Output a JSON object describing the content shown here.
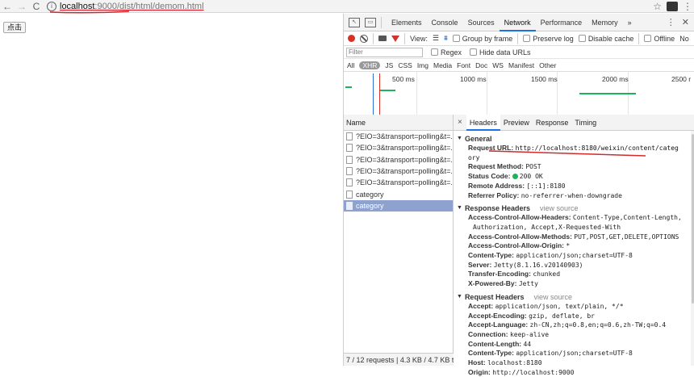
{
  "browser": {
    "url_host": "localhost",
    "url_rest": ":9000/dist/html/demom.html"
  },
  "page": {
    "button_label": "点击"
  },
  "devtools": {
    "tabs": [
      "Elements",
      "Console",
      "Sources",
      "Network",
      "Performance",
      "Memory"
    ],
    "more_tabs": "»",
    "toolbar": {
      "view_label": "View:",
      "group_by_frame": "Group by frame",
      "preserve_log": "Preserve log",
      "disable_cache": "Disable cache",
      "offline": "Offline",
      "no_throttling": "No"
    },
    "filter": {
      "placeholder": "Filter",
      "regex": "Regex",
      "hide_data_urls": "Hide data URLs"
    },
    "types": [
      "All",
      "XHR",
      "JS",
      "CSS",
      "Img",
      "Media",
      "Font",
      "Doc",
      "WS",
      "Manifest",
      "Other"
    ],
    "active_type": "XHR",
    "overview_ticks": [
      "500 ms",
      "1000 ms",
      "1500 ms",
      "2000 ms",
      "2500 r"
    ],
    "name_header": "Name",
    "requests": [
      "?EIO=3&transport=polling&t=...",
      "?EIO=3&transport=polling&t=...",
      "?EIO=3&transport=polling&t=...",
      "?EIO=3&transport=polling&t=...",
      "?EIO=3&transport=polling&t=...",
      "category",
      "category"
    ],
    "selected_request_index": 6,
    "status_bar": "7 / 12 requests | 4.3 KB / 4.7 KB t...",
    "detail_tabs": [
      "Headers",
      "Preview",
      "Response",
      "Timing"
    ],
    "active_detail_tab": "Headers",
    "general": {
      "title": "General",
      "request_url_label": "Request URL:",
      "request_url_line1": "http://localhost:8180/weixin/content/categ",
      "request_url_line2": "ory",
      "request_method_label": "Request Method:",
      "request_method": "POST",
      "status_code_label": "Status Code:",
      "status_code": "200 OK",
      "status_color": "#1db35c",
      "remote_address_label": "Remote Address:",
      "remote_address": "[::1]:8180",
      "referrer_policy_label": "Referrer Policy:",
      "referrer_policy": "no-referrer-when-downgrade"
    },
    "response_headers": {
      "title": "Response Headers",
      "view_source": "view source",
      "acah_label": "Access-Control-Allow-Headers:",
      "acah_line1": "Content-Type,Content-Length,",
      "acah_line2": "Authorization, Accept,X-Requested-With",
      "acam_label": "Access-Control-Allow-Methods:",
      "acam": "PUT,POST,GET,DELETE,OPTIONS",
      "acao_label": "Access-Control-Allow-Origin:",
      "acao": "*",
      "content_type_label": "Content-Type:",
      "content_type": "application/json;charset=UTF-8",
      "server_label": "Server:",
      "server": "Jetty(8.1.16.v20140903)",
      "transfer_encoding_label": "Transfer-Encoding:",
      "transfer_encoding": "chunked",
      "x_powered_by_label": "X-Powered-By:",
      "x_powered_by": "Jetty"
    },
    "request_headers": {
      "title": "Request Headers",
      "view_source": "view source",
      "accept_label": "Accept:",
      "accept": "application/json, text/plain, */*",
      "accept_encoding_label": "Accept-Encoding:",
      "accept_encoding": "gzip, deflate, br",
      "accept_language_label": "Accept-Language:",
      "accept_language": "zh-CN,zh;q=0.8,en;q=0.6,zh-TW;q=0.4",
      "connection_label": "Connection:",
      "connection": "keep-alive",
      "content_length_label": "Content-Length:",
      "content_length": "44",
      "content_type_label": "Content-Type:",
      "content_type": "application/json;charset=UTF-8",
      "host_label": "Host:",
      "host": "localhost:8180",
      "origin_label": "Origin:",
      "origin": "http://localhost:9000"
    }
  },
  "colors": {
    "annotation_red": "#d12b2b",
    "accent_blue": "#1a73e8",
    "selected_row": "#8da2cf"
  }
}
